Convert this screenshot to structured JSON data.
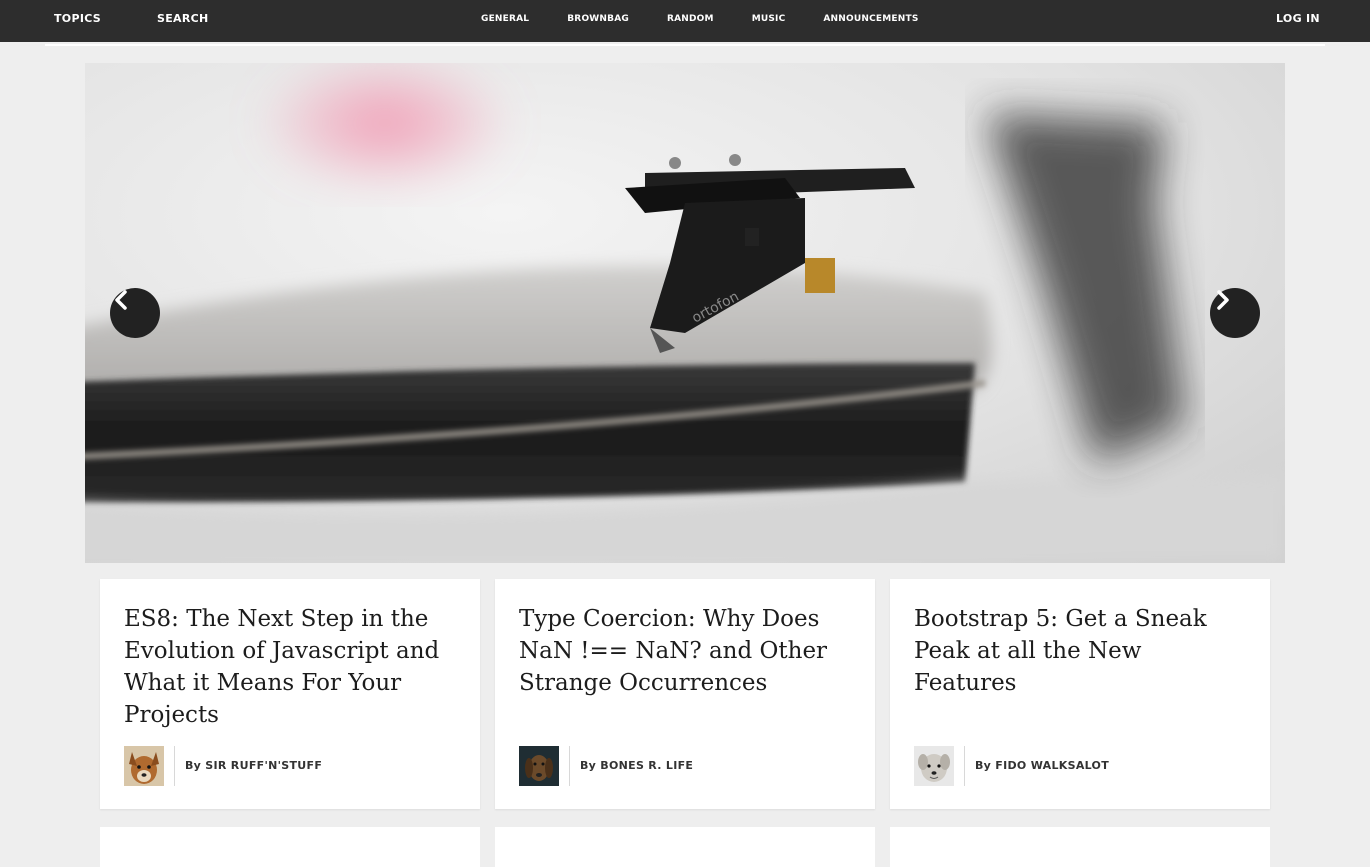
{
  "nav": {
    "topics": "TOPICS",
    "search": "SEARCH",
    "login": "LOG IN",
    "categories": [
      "GENERAL",
      "BROWNBAG",
      "RANDOM",
      "MUSIC",
      "ANNOUNCEMENTS"
    ]
  },
  "hero": {
    "prev_icon": "chevron-left-icon",
    "next_icon": "chevron-right-icon",
    "cartridge_text": "ortofon"
  },
  "articles": [
    {
      "title": "ES8: The Next Step in the Evolution of Javascript and What it Means For Your Projects",
      "by": "By",
      "author": "SIR RUFF'N'STUFF"
    },
    {
      "title": "Type Coercion: Why Does NaN !== NaN? and Other Strange Occurrences",
      "by": "By",
      "author": "BONES R. LIFE"
    },
    {
      "title": "Bootstrap 5: Get a Sneak Peak at all the New Features",
      "by": "By",
      "author": "FIDO WALKSALOT"
    }
  ],
  "colors": {
    "nav_bg": "#2d2d2d",
    "page_bg": "#eeeeee",
    "card_bg": "#ffffff",
    "arrow_bg": "#222222"
  }
}
